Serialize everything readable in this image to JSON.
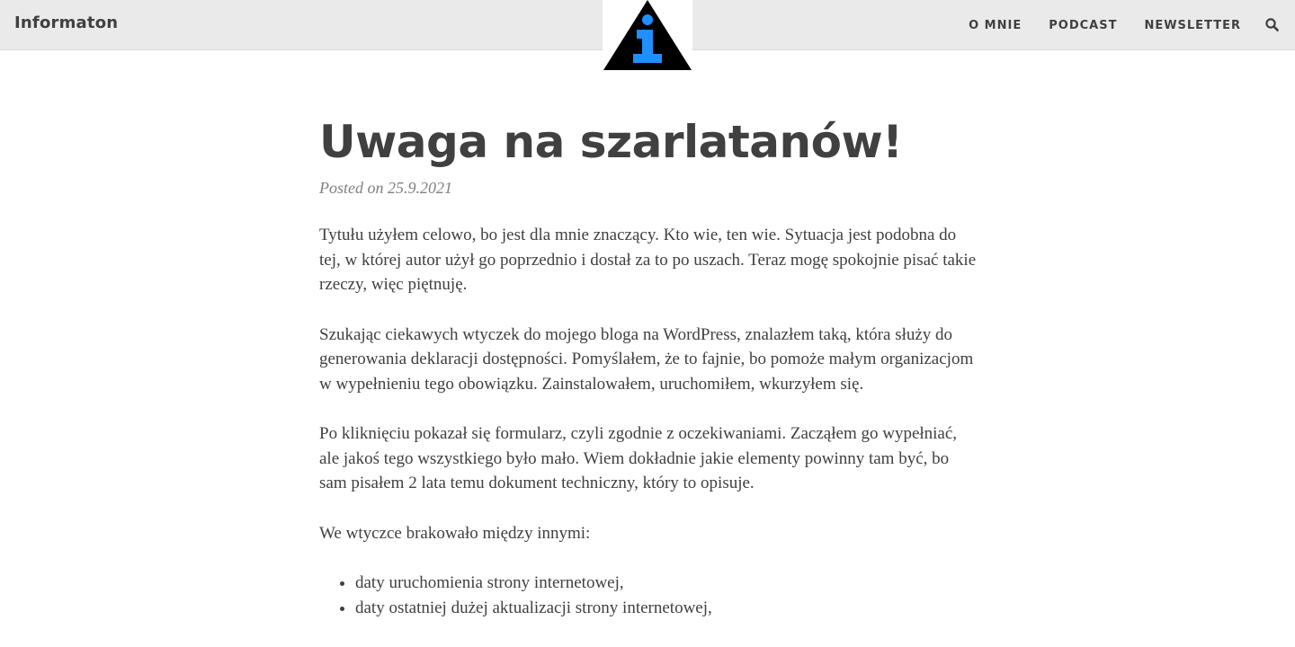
{
  "header": {
    "brand": "Informaton",
    "logo_letter": "i",
    "nav_items": [
      "O MNIE",
      "PODCAST",
      "NEWSLETTER"
    ],
    "search_icon": "search-icon"
  },
  "colors": {
    "navbar_bg": "#eaeaea",
    "logo_triangle": "#000000",
    "logo_letter": "#1e90ff",
    "text": "#404040",
    "meta": "#808080"
  },
  "post": {
    "title": "Uwaga na szarlatanów!",
    "meta_prefix": "Posted on",
    "date": "25.9.2021",
    "paragraphs": [
      "Tytułu użyłem celowo, bo jest dla mnie znaczący. Kto wie, ten wie. Sytuacja jest podobna do tej, w której autor użył go poprzednio i dostał za to po uszach. Teraz mogę spokojnie pisać takie rzeczy, więc piętnuję.",
      "Szukając ciekawych wtyczek do mojego bloga na WordPress, znalazłem taką, która służy do generowania deklaracji dostępności. Pomyślałem, że to fajnie, bo pomoże małym organizacjom w wypełnieniu tego obowiązku. Zainstalowałem, uruchomiłem, wkurzyłem się.",
      "Po kliknięciu pokazał się formularz, czyli zgodnie z oczekiwaniami. Zacząłem go wypełniać, ale jakoś tego wszystkiego było mało. Wiem dokładnie jakie elementy powinny tam być, bo sam pisałem 2 lata temu dokument techniczny, który to opisuje.",
      "We wtyczce brakowało między innymi:"
    ],
    "list_items": [
      "daty uruchomienia strony internetowej,",
      "daty ostatniej dużej aktualizacji strony internetowej,"
    ]
  }
}
